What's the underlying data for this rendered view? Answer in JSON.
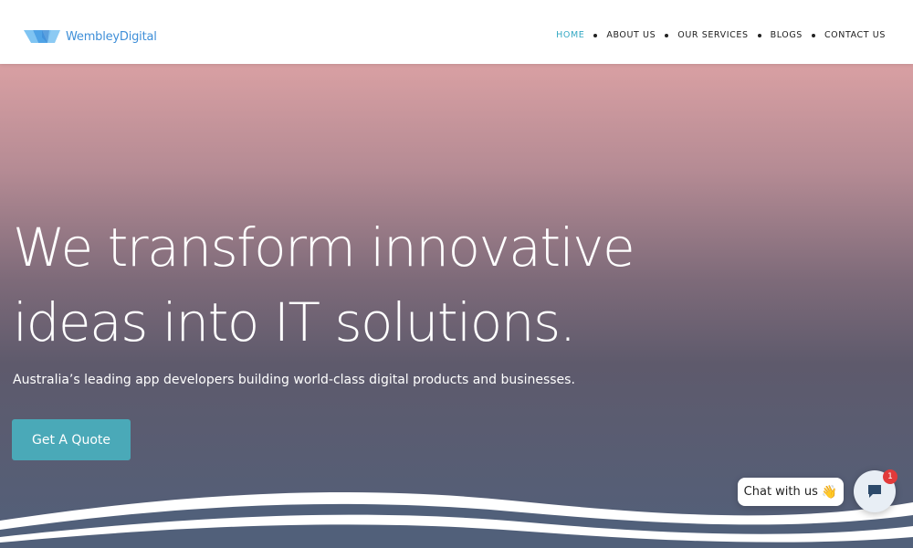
{
  "brand": {
    "name": "WembleyDigital",
    "logo_color_light": "#7fc4f2",
    "logo_color_dark": "#3f8fd8"
  },
  "nav": {
    "items": [
      {
        "label": "HOME",
        "active": true
      },
      {
        "label": "ABOUT US",
        "active": false
      },
      {
        "label": "OUR SERVICES",
        "active": false
      },
      {
        "label": "BLOGS",
        "active": false
      },
      {
        "label": "CONTACT US",
        "active": false
      }
    ],
    "active_color": "#35a9c4"
  },
  "hero": {
    "title_line1": "We transform innovative",
    "title_line2": "ideas into IT solutions.",
    "subtitle": "Australia’s leading app developers building world-class digital products and businesses.",
    "cta_label": "Get A Quote",
    "cta_color": "#4aa9b8"
  },
  "chat": {
    "bubble_text": "Chat with us",
    "bubble_emoji": "👋",
    "badge_count": "1",
    "icon": "chat-icon"
  }
}
